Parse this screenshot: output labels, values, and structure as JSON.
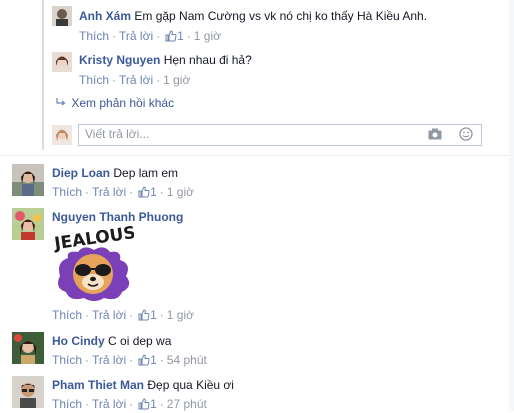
{
  "colors": {
    "name": "#3b5998",
    "link": "#6d84b4",
    "meta": "#9197a3",
    "accent_line": "#dcdee3"
  },
  "actions": {
    "like_label": "Thích",
    "reply_label": "Trả lời"
  },
  "replies": [
    {
      "author": "Anh Xám",
      "text": "Em gặp Nam Cường vs vk nó chị ko thấy Hà Kiều Anh.",
      "likes": "1",
      "time": "1 giờ"
    },
    {
      "author": "Kristy Nguyen",
      "text": "Hẹn nhau đi hả?",
      "time": "1 giờ"
    }
  ],
  "more_replies": {
    "label": "Xem phản hồi khác",
    "icon": "reply-arrow-icon"
  },
  "reply_input": {
    "placeholder": "Viết trả lời...",
    "camera_icon": "camera-icon",
    "emoji_icon": "emoji-icon"
  },
  "comments": [
    {
      "author": "Diep Loan",
      "text": "Dep lam em",
      "likes": "1",
      "time": "1 giờ"
    },
    {
      "author": "Nguyen Thanh Phuong",
      "text": "",
      "sticker": "JEALOUS?",
      "likes": "1",
      "time": "1 giờ"
    },
    {
      "author": "Ho Cindy",
      "text": "C oi dep wa",
      "likes": "1",
      "time": "54 phút"
    },
    {
      "author": "Pham Thiet Man",
      "text": "Đẹp qua Kiều ơi",
      "likes": "1",
      "time": "27 phút"
    }
  ]
}
